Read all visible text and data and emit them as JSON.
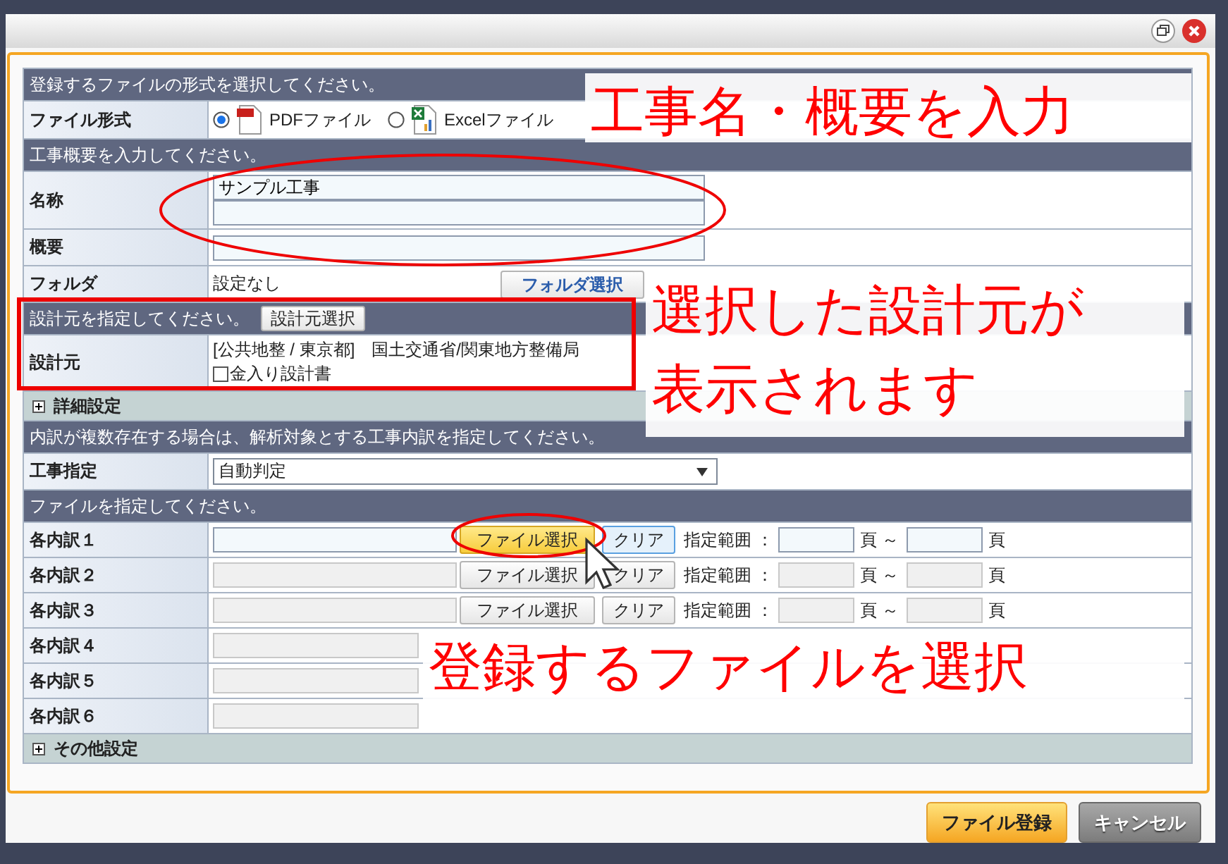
{
  "form": [
    {
      "kind": "header",
      "text": "登録するファイルの形式を選択してください。"
    },
    {
      "kind": "radio",
      "label": "ファイル形式",
      "options": [
        {
          "label": "PDFファイル",
          "selected": true
        },
        {
          "label": "Excelファイル",
          "selected": false
        }
      ]
    },
    {
      "kind": "header",
      "text": "工事概要を入力してください。"
    },
    {
      "kind": "name",
      "label": "名称",
      "value": "サンプル工事"
    },
    {
      "kind": "input",
      "label": "概要"
    },
    {
      "kind": "folder",
      "label": "フォルダ",
      "value": "設定なし",
      "button": "フォルダ選択"
    },
    {
      "kind": "header",
      "text": "設計元を指定してください。",
      "button": "設計元選択"
    },
    {
      "kind": "designer",
      "label": "設計元",
      "value": "[公共地整 / 東京都]　国土交通省/関東地方整備局",
      "checkbox": {
        "label": "金入り設計書",
        "checked": false
      }
    },
    {
      "kind": "expander",
      "text": "詳細設定",
      "expanded": false
    },
    {
      "kind": "header",
      "text": "内訳が複数存在する場合は、解析対象とする工事内訳を指定してください。"
    },
    {
      "kind": "select",
      "label": "工事指定",
      "value": "自動判定"
    },
    {
      "kind": "header",
      "text": "ファイルを指定してください。"
    }
  ],
  "files": [
    {
      "kind": "full",
      "label": "各内訳１",
      "enabled": true,
      "highlighted": true,
      "button": "ファイル選択",
      "clear": "クリア",
      "range": "指定範囲 ：",
      "from_unit": "頁 ～",
      "to_unit": "頁"
    },
    {
      "kind": "full",
      "label": "各内訳２",
      "enabled": false,
      "highlighted": false,
      "button": "ファイル選択",
      "clear": "クリア",
      "range": "指定範囲 ：",
      "from_unit": "頁 ～",
      "to_unit": "頁"
    },
    {
      "kind": "full",
      "label": "各内訳３",
      "enabled": false,
      "highlighted": false,
      "button": "ファイル選択",
      "clear": "クリア",
      "range": "指定範囲 ：",
      "from_unit": "頁 ～",
      "to_unit": "頁"
    },
    {
      "kind": "partial",
      "label": "各内訳４",
      "enabled": false
    },
    {
      "kind": "partial",
      "label": "各内訳５",
      "enabled": false
    },
    {
      "kind": "partial",
      "label": "各内訳６",
      "enabled": false
    }
  ],
  "other_settings": {
    "text": "その他設定",
    "expanded": false
  },
  "footer": [
    {
      "kind": "primary",
      "label": "ファイル登録"
    },
    {
      "kind": "secondary",
      "label": "キャンセル"
    }
  ],
  "callouts": [
    {
      "lines": [
        "工事名・概要を入力"
      ]
    },
    {
      "lines": [
        "選択した設計元が",
        "表示されます"
      ]
    },
    {
      "lines": [
        "登録するファイルを選択"
      ]
    }
  ]
}
